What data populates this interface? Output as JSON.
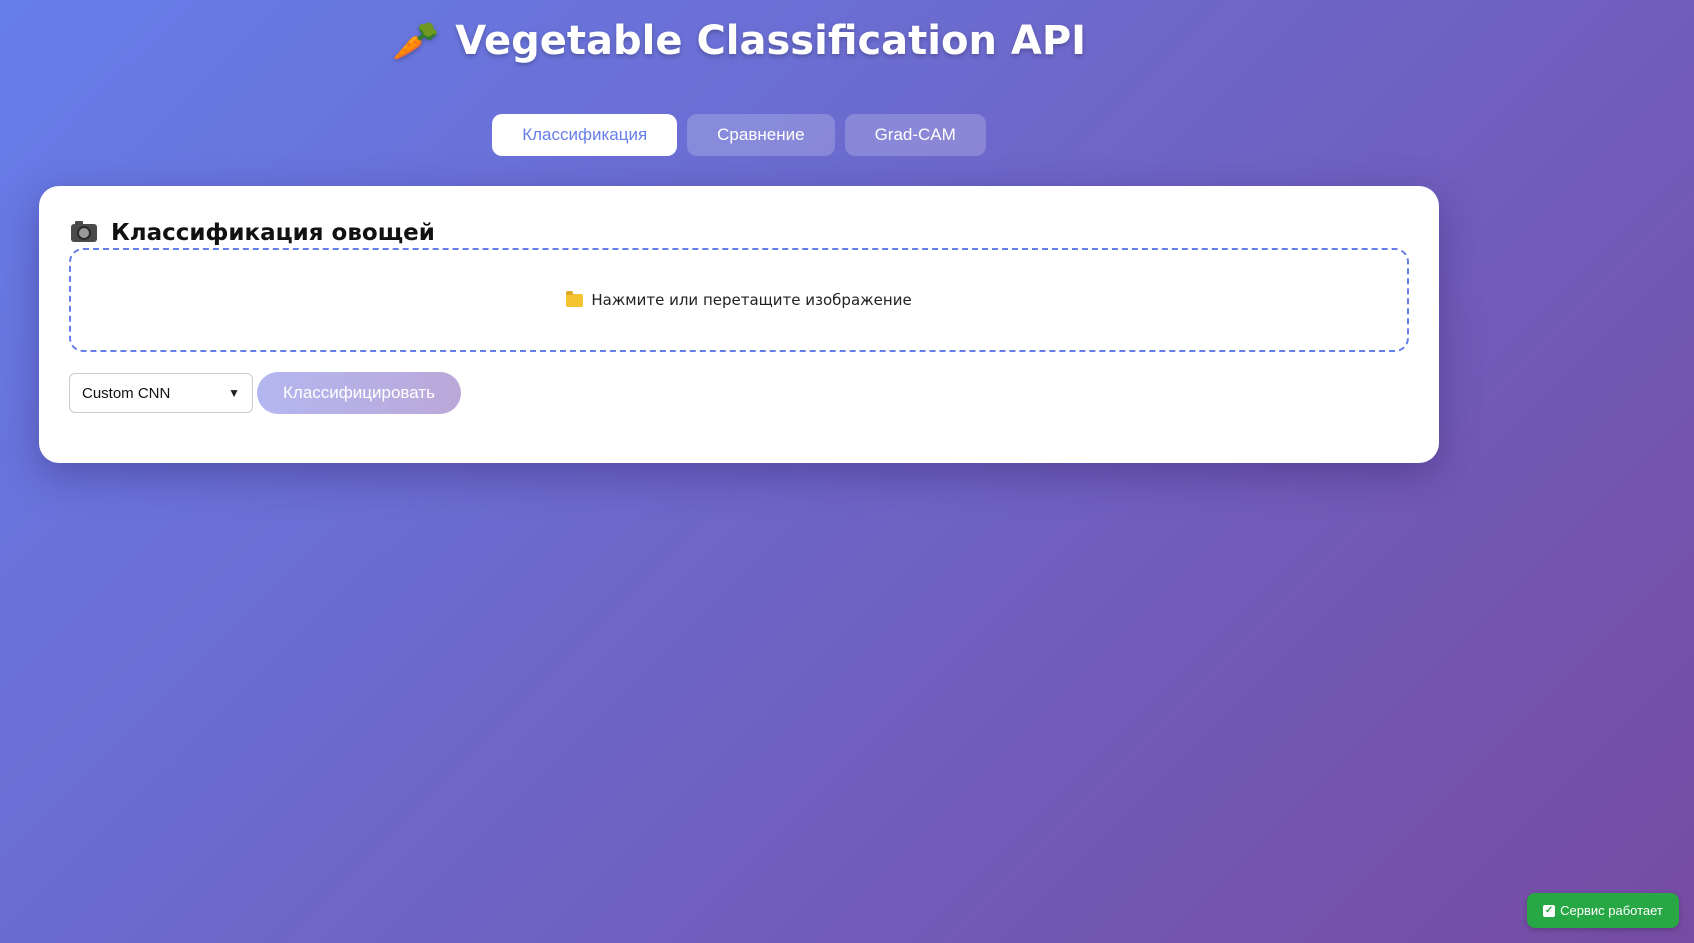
{
  "header": {
    "title": "Vegetable Classification API",
    "icon": "carrot-icon"
  },
  "tabs": [
    {
      "label": "Классификация",
      "active": true
    },
    {
      "label": "Сравнение",
      "active": false
    },
    {
      "label": "Grad-CAM",
      "active": false
    }
  ],
  "classify_panel": {
    "title": "Классификация овощей",
    "title_icon": "camera-icon",
    "dropzone_icon": "folder-icon",
    "dropzone_text": "Нажмите или перетащите изображение",
    "model_select": {
      "selected": "Custom CNN"
    },
    "classify_button": "Классифицировать"
  },
  "status": {
    "icon": "check-icon",
    "text": "Сервис работает"
  },
  "colors": {
    "gradient_start": "#667eea",
    "gradient_end": "#764ba2",
    "accent": "#667eea",
    "status_green": "#28a745"
  }
}
